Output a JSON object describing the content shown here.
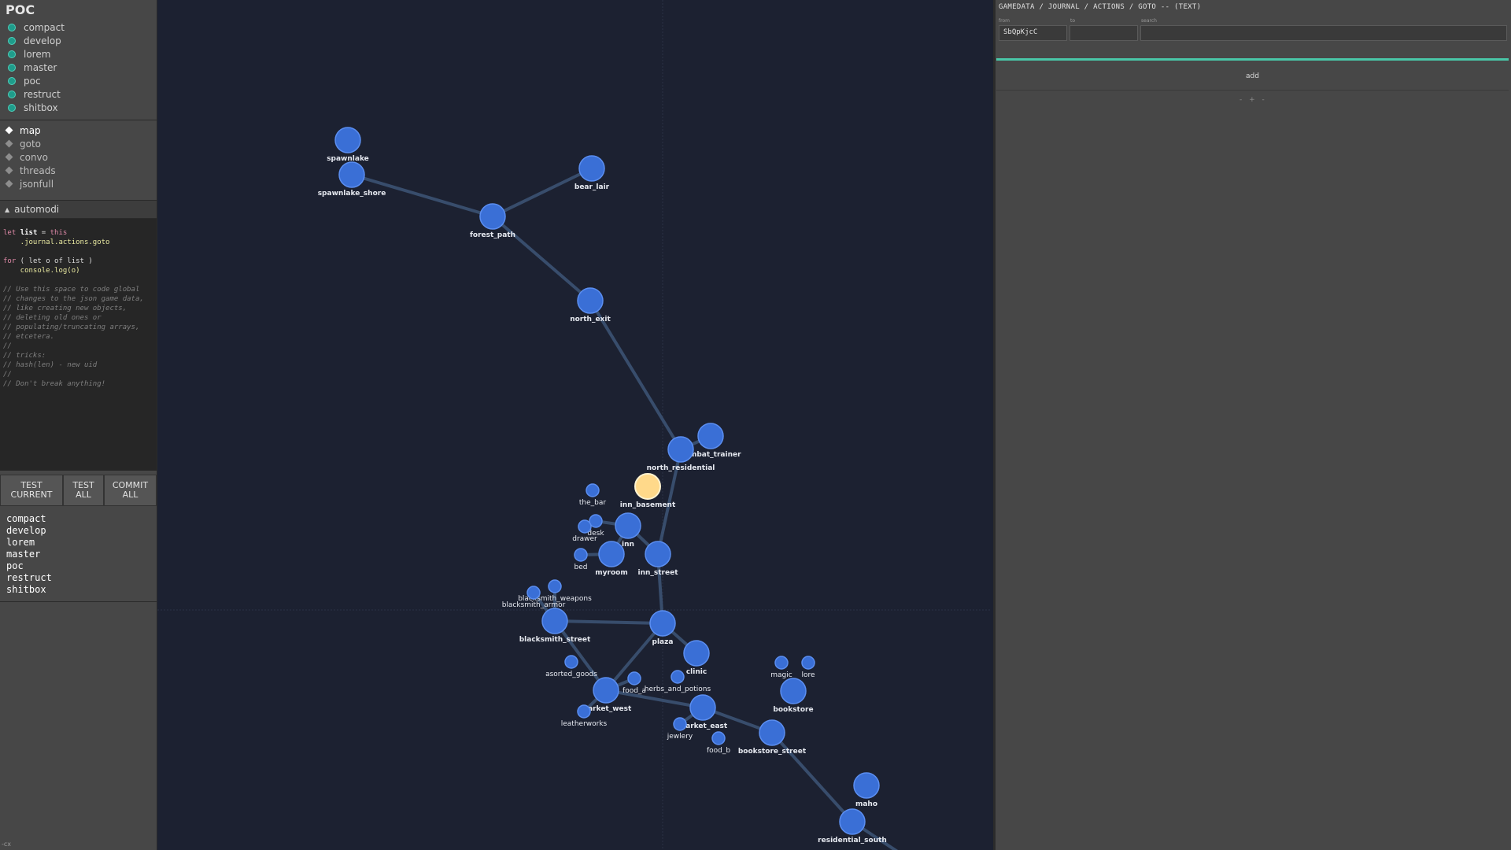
{
  "app": {
    "title": "POC"
  },
  "branches": [
    "compact",
    "develop",
    "lorem",
    "master",
    "poc",
    "restruct",
    "shitbox"
  ],
  "views": [
    {
      "label": "map",
      "active": true
    },
    {
      "label": "goto",
      "active": false
    },
    {
      "label": "convo",
      "active": false
    },
    {
      "label": "threads",
      "active": false
    },
    {
      "label": "jsonfull",
      "active": false
    }
  ],
  "automodi": {
    "header": "automodi",
    "code": {
      "line1_kw": "let",
      "line1_var": "list",
      "line1_eq": " = ",
      "line1_this": "this",
      "line2": "    .journal.actions.goto",
      "line3_kw": "for",
      "line3_rest": " ( let o of list )",
      "line4": "    console.log(o)",
      "comments": [
        "// Use this space to code global",
        "// changes to the json game data,",
        "// like creating new objects,",
        "// deleting old ones or",
        "// populating/truncating arrays,",
        "// etcetera.",
        "//",
        "// tricks:",
        "// hash(len) - new uid",
        "//",
        "// Don't break anything!"
      ]
    }
  },
  "buttons": {
    "test_current": "TEST CURRENT",
    "test_all": "TEST ALL",
    "commit_all": "COMMIT ALL"
  },
  "results": [
    "compact",
    "develop",
    "lorem",
    "master",
    "poc",
    "restruct",
    "shitbox"
  ],
  "footer": "-cx",
  "map": {
    "nodes": [
      {
        "id": "spawnlake",
        "big": true,
        "highlight": false
      },
      {
        "id": "spawnlake_shore",
        "big": true,
        "highlight": false
      },
      {
        "id": "bear_lair",
        "big": true,
        "highlight": false
      },
      {
        "id": "forest_path",
        "big": true,
        "highlight": false
      },
      {
        "id": "north_exit",
        "big": true,
        "highlight": false
      },
      {
        "id": "combat_trainer",
        "big": true,
        "highlight": false
      },
      {
        "id": "north_residential",
        "big": true,
        "highlight": false
      },
      {
        "id": "inn_basement",
        "big": true,
        "highlight": true
      },
      {
        "id": "the_bar",
        "big": false,
        "highlight": false
      },
      {
        "id": "desk",
        "big": false,
        "highlight": false
      },
      {
        "id": "drawer",
        "big": false,
        "highlight": false
      },
      {
        "id": "inn",
        "big": true,
        "highlight": false
      },
      {
        "id": "bed",
        "big": false,
        "highlight": false
      },
      {
        "id": "myroom",
        "big": true,
        "highlight": false
      },
      {
        "id": "inn_street",
        "big": true,
        "highlight": false
      },
      {
        "id": "blacksmith_weapons",
        "big": false,
        "highlight": false
      },
      {
        "id": "blacksmith_armor",
        "big": false,
        "highlight": false
      },
      {
        "id": "blacksmith_street",
        "big": true,
        "highlight": false
      },
      {
        "id": "plaza",
        "big": true,
        "highlight": false
      },
      {
        "id": "clinic",
        "big": true,
        "highlight": false
      },
      {
        "id": "asorted_goods",
        "big": false,
        "highlight": false
      },
      {
        "id": "food_a",
        "big": false,
        "highlight": false
      },
      {
        "id": "herbs_and_potions",
        "big": false,
        "highlight": false
      },
      {
        "id": "magic",
        "big": false,
        "highlight": false
      },
      {
        "id": "lore",
        "big": false,
        "highlight": false
      },
      {
        "id": "bookstore",
        "big": true,
        "highlight": false
      },
      {
        "id": "market_west",
        "big": true,
        "highlight": false
      },
      {
        "id": "leatherworks",
        "big": false,
        "highlight": false
      },
      {
        "id": "market_east",
        "big": true,
        "highlight": false
      },
      {
        "id": "jewlery",
        "big": false,
        "highlight": false
      },
      {
        "id": "food_b",
        "big": false,
        "highlight": false
      },
      {
        "id": "bookstore_street",
        "big": true,
        "highlight": false
      },
      {
        "id": "maho",
        "big": true,
        "highlight": false
      },
      {
        "id": "residential_south",
        "big": true,
        "highlight": false
      }
    ],
    "edges": [
      [
        "spawnlake_shore",
        "forest_path"
      ],
      [
        "bear_lair",
        "forest_path"
      ],
      [
        "forest_path",
        "north_exit"
      ],
      [
        "north_exit",
        "north_residential"
      ],
      [
        "north_residential",
        "combat_trainer"
      ],
      [
        "north_residential",
        "inn_street"
      ],
      [
        "inn",
        "inn_street"
      ],
      [
        "inn",
        "myroom"
      ],
      [
        "inn",
        "desk"
      ],
      [
        "myroom",
        "bed"
      ],
      [
        "inn_street",
        "plaza"
      ],
      [
        "blacksmith_street",
        "plaza"
      ],
      [
        "blacksmith_street",
        "blacksmith_armor"
      ],
      [
        "blacksmith_street",
        "blacksmith_weapons"
      ],
      [
        "blacksmith_street",
        "market_west"
      ],
      [
        "plaza",
        "clinic"
      ],
      [
        "plaza",
        "market_west"
      ],
      [
        "market_west",
        "market_east"
      ],
      [
        "market_west",
        "food_a"
      ],
      [
        "market_west",
        "leatherworks"
      ],
      [
        "market_east",
        "jewlery"
      ],
      [
        "market_east",
        "bookstore_street"
      ],
      [
        "bookstore_street",
        "residential_south"
      ],
      [
        "residential_south",
        "offscreen_south"
      ]
    ]
  },
  "right_panel": {
    "breadcrumb": "GAMEDATA / JOURNAL / ACTIONS / GOTO -- (TEXT)",
    "from_label": "from",
    "to_label": "to",
    "search_label": "search",
    "from_value": "SbQpKjcC",
    "to_value": "",
    "search_value": "",
    "add_label": "add",
    "add_sub": "- + -"
  },
  "colors": {
    "accent": "#49c7a8",
    "node": "#3a6fd6",
    "node_highlight": "#ffd98a",
    "edge": "#3d5577"
  }
}
